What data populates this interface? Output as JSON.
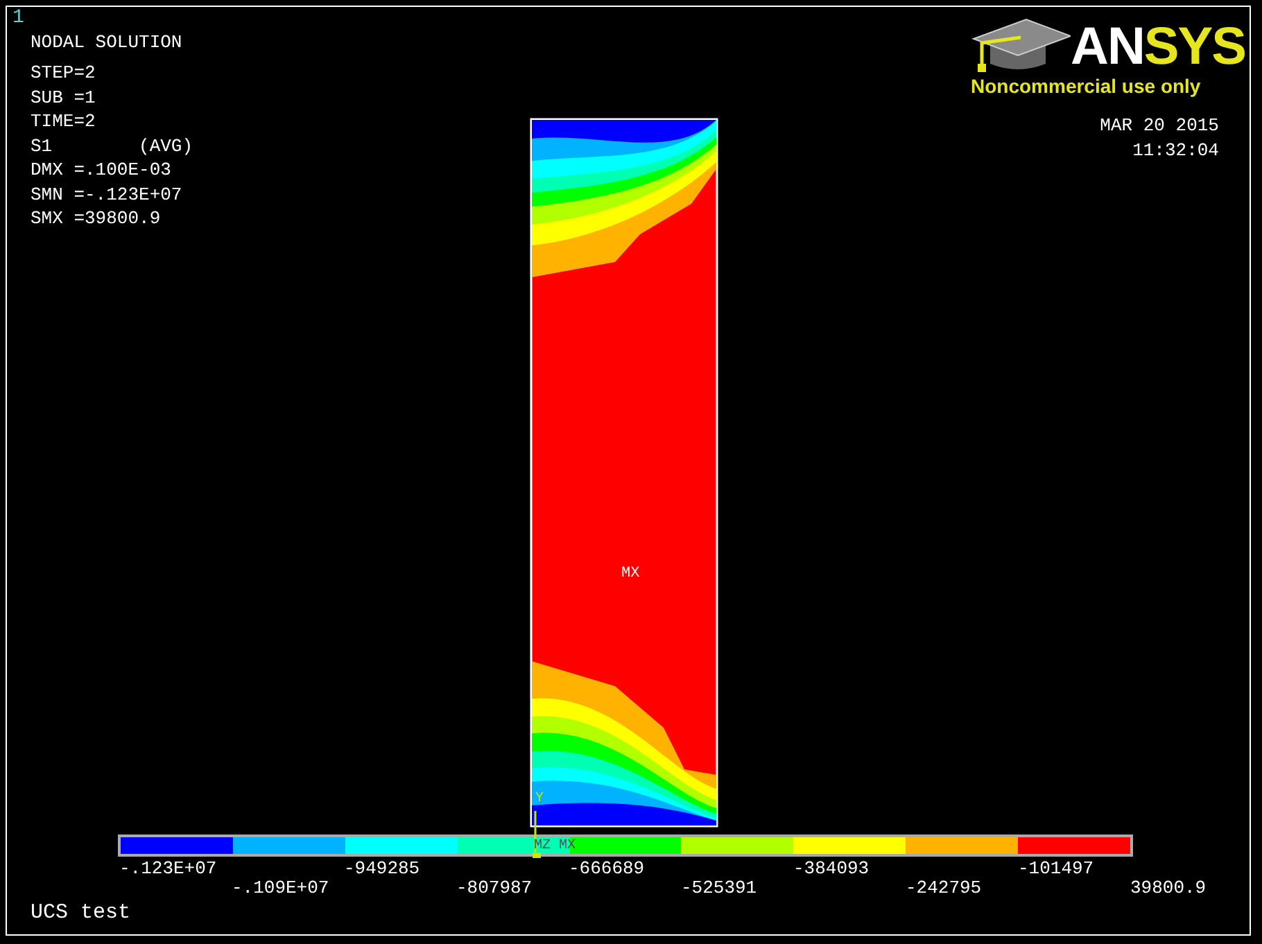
{
  "window": {
    "number": "1"
  },
  "info": {
    "title": "NODAL SOLUTION",
    "lines": [
      "STEP=2",
      "SUB =1",
      "TIME=2",
      "S1        (AVG)",
      "DMX =.100E-03",
      "SMN =-.123E+07",
      "SMX =39800.9"
    ]
  },
  "logo": {
    "wordmark": [
      {
        "text": "AN",
        "color": "#ffffff"
      },
      {
        "text": "SYS",
        "color": "#e6e61e"
      }
    ],
    "notice": "Noncommercial use only"
  },
  "timestamp": {
    "date": "MAR 20 2015",
    "time": "11:32:04"
  },
  "plot": {
    "max_label": "MX",
    "triad": {
      "y_label": "Y",
      "labels": [
        "MZ",
        "MX"
      ]
    }
  },
  "legend": {
    "bands": [
      {
        "color": "#0000ff"
      },
      {
        "color": "#00b2ff"
      },
      {
        "color": "#00ffff"
      },
      {
        "color": "#00ffb2"
      },
      {
        "color": "#00ff00"
      },
      {
        "color": "#b2ff00"
      },
      {
        "color": "#ffff00"
      },
      {
        "color": "#ffb200"
      },
      {
        "color": "#ff0000"
      }
    ],
    "ticks": [
      "-.123E+07",
      "-.109E+07",
      "-949285",
      "-807987",
      "-666689",
      "-525391",
      "-384093",
      "-242795",
      "-101497",
      "39800.9"
    ]
  },
  "footer": {
    "title": "UCS test"
  }
}
